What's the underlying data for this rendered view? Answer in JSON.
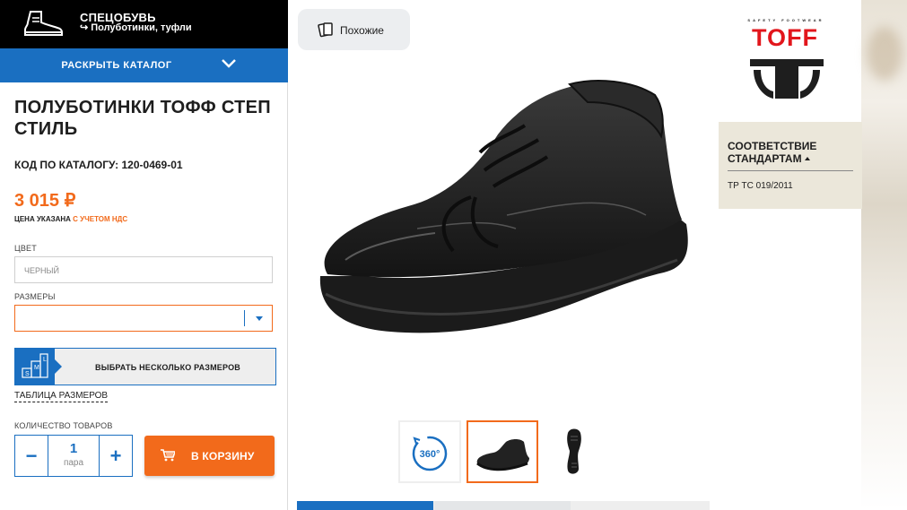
{
  "category": {
    "title": "СПЕЦОБУВЬ",
    "subtitle": "Полуботинки, туфли",
    "icon": "boot-icon",
    "back_icon": "return-arrow-icon"
  },
  "catalog_bar": {
    "label": "РАСКРЫТЬ КАТАЛОГ",
    "icon": "chevron-down-icon"
  },
  "product": {
    "title": "ПОЛУБОТИНКИ ТОФФ СТЕП СТИЛЬ",
    "code": "КОД ПО КАТАЛОГУ: 120-0469-01",
    "price": "3 015 ₽",
    "price_note_prefix": "ЦЕНА УКАЗАНА ",
    "price_note_accent": "С УЧЕТОМ НДС"
  },
  "color": {
    "label": "ЦВЕТ",
    "value": "ЧЕРНЫЙ"
  },
  "sizes": {
    "label": "РАЗМЕРЫ",
    "value": "",
    "multi_label": "ВЫБРАТЬ НЕСКОЛЬКО РАЗМЕРОВ",
    "multi_icon": "size-grid-icon",
    "size_letters": [
      "L",
      "M",
      "S"
    ],
    "table_link": "ТАБЛИЦА РАЗМЕРОВ"
  },
  "quantity": {
    "label": "КОЛИЧЕСТВО ТОВАРОВ",
    "minus": "−",
    "plus": "+",
    "value": "1",
    "unit": "пара"
  },
  "cart": {
    "label": "В КОРЗИНУ",
    "icon": "cart-icon"
  },
  "gallery": {
    "similar_label": "Похожие",
    "similar_icon": "similar-cards-icon",
    "thumb_360_label": "360°",
    "thumbnails": [
      "360-view-icon",
      "shoe-side-thumbnail",
      "shoe-sole-thumbnail"
    ],
    "selected_thumbnail": 1
  },
  "brand": {
    "tagline": "SAFETY FOOTWEAR",
    "name": "TOFF"
  },
  "standards": {
    "heading": "СООТВЕТСТВИЕ СТАНДАРТАМ",
    "value": "ТР ТС 019/2011"
  },
  "colors": {
    "accent_orange": "#f26a1b",
    "primary_blue": "#1a6fc1",
    "header_black": "#000000",
    "brand_red": "#e2161c",
    "standards_bg": "#ebe7da"
  }
}
